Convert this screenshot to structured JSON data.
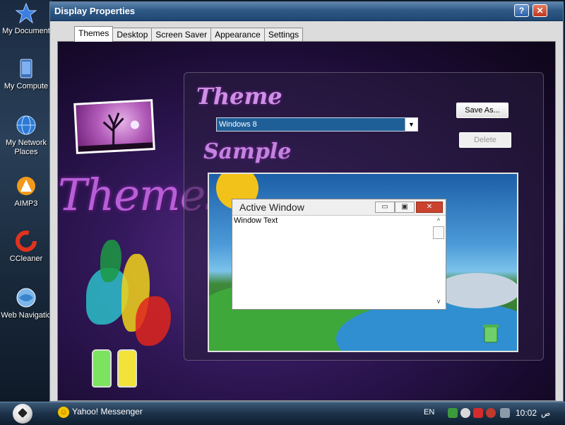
{
  "desktop": {
    "icons": [
      {
        "label": "My Document",
        "icon": "star-icon"
      },
      {
        "label": "My Compute",
        "icon": "computer-icon"
      },
      {
        "label": "My Network Places",
        "icon": "network-globe-icon"
      },
      {
        "label": "AIMP3",
        "icon": "aimp3-icon"
      },
      {
        "label": "CCleaner",
        "icon": "ccleaner-icon"
      },
      {
        "label": "Web Navigatio",
        "icon": "web-navigator-icon"
      }
    ]
  },
  "window": {
    "title": "Display Properties",
    "help_label": "?",
    "close_label": "✕",
    "tabs": [
      "Themes",
      "Desktop",
      "Screen Saver",
      "Appearance",
      "Settings"
    ],
    "active_tab": "Themes"
  },
  "themes_tab": {
    "art_heading": "Themes",
    "theme_label": "Theme",
    "theme_select_value": "Windows 8",
    "save_as_label": "Save As...",
    "delete_label": "Delete",
    "sample_label": "Sample"
  },
  "preview": {
    "window_title": "Active Window",
    "window_text": "Window Text",
    "min_label": "▭",
    "max_label": "▣",
    "close_label": "✕",
    "scroll_up": "^",
    "scroll_down": "v"
  },
  "taskbar": {
    "app_label": "Yahoo! Messenger",
    "language": "EN",
    "time": "10:02",
    "ampm": "ص"
  },
  "colors": {
    "titlebar": "#2f5a86",
    "selection": "#1f5f98",
    "close_red": "#c2351b",
    "purple_accent": "#b85fd8"
  }
}
